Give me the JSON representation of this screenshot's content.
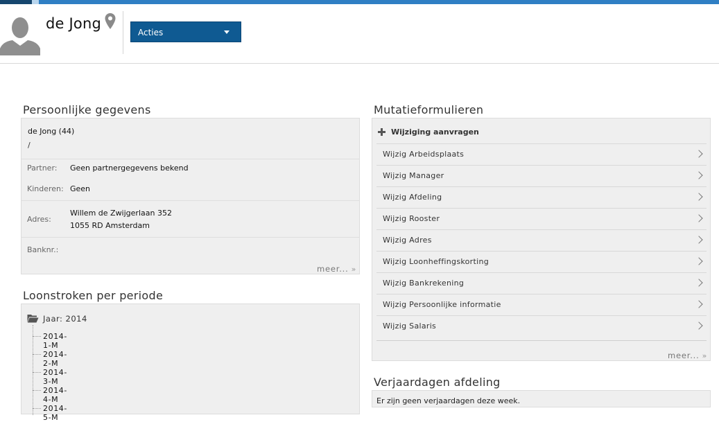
{
  "header": {
    "name": "de Jong",
    "acties_label": "Acties"
  },
  "persoonlijk": {
    "title": "Persoonlijke gegevens",
    "name_age": "de Jong (44)",
    "slash": "/",
    "partner_label": "Partner:",
    "partner_value": "Geen partnergegevens bekend",
    "kinderen_label": "Kinderen:",
    "kinderen_value": "Geen",
    "adres_label": "Adres:",
    "adres_line1": "Willem de Zwijgerlaan 352",
    "adres_line2": "1055 RD Amsterdam",
    "banknr_label": "Banknr.:",
    "meer": "meer..."
  },
  "loonstroken": {
    "title": "Loonstroken per periode",
    "jaar": "Jaar: 2014",
    "items": [
      "2014-1-M",
      "2014-2-M",
      "2014-3-M",
      "2014-4-M",
      "2014-5-M"
    ]
  },
  "mutatie": {
    "title": "Mutatieformulieren",
    "aanvragen": "Wijziging aanvragen",
    "items": [
      "Wijzig Arbeidsplaats",
      "Wijzig Manager",
      "Wijzig Afdeling",
      "Wijzig Rooster",
      "Wijzig Adres",
      "Wijzig Loonheffingskorting",
      "Wijzig Bankrekening",
      "Wijzig Persoonlijke informatie",
      "Wijzig Salaris"
    ],
    "meer": "meer..."
  },
  "verjaardagen": {
    "title": "Verjaardagen afdeling",
    "text": "Er zijn geen verjaardagen deze week."
  },
  "colors": {
    "accent_blue": "#2f7fc4",
    "button_blue": "#0f5a92"
  }
}
